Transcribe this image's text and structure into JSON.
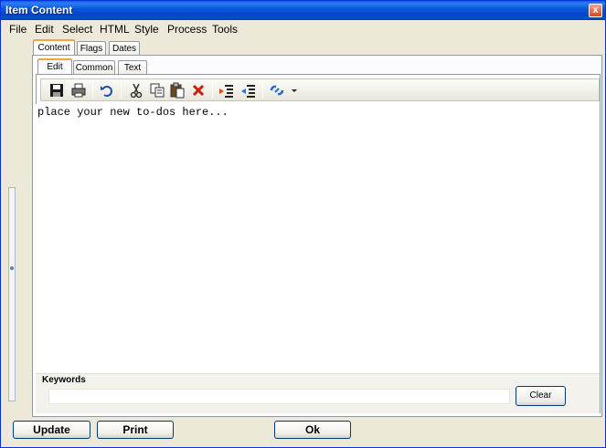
{
  "window": {
    "title": "Item Content",
    "close_glyph": "x"
  },
  "menu": [
    "File",
    "Edit",
    "Select",
    "HTML",
    "Style",
    "Process",
    "Tools"
  ],
  "outer_tabs": [
    "Content",
    "Flags",
    "Dates"
  ],
  "inner_tabs": [
    "Edit",
    "Common",
    "Text"
  ],
  "toolbar_icons": [
    "save-icon",
    "print-icon",
    "undo-icon",
    "cut-icon",
    "copy-icon",
    "paste-icon",
    "delete-icon",
    "indent-icon",
    "outdent-icon",
    "link-icon",
    "dropdown-arrow-icon"
  ],
  "editor": {
    "content": "place your new to-dos here..."
  },
  "keywords": {
    "label": "Keywords",
    "value": "",
    "clear_label": "Clear"
  },
  "buttons": {
    "update": "Update",
    "print": "Print",
    "ok": "Ok"
  }
}
